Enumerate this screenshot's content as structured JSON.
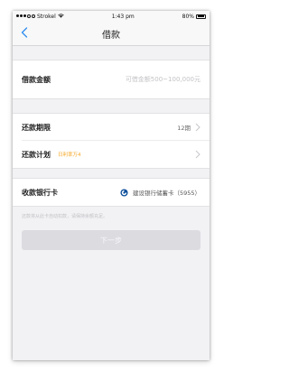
{
  "status_bar": {
    "carrier": "Strokel",
    "time": "1:43 pm",
    "battery": "80%",
    "battery_level": 0.8
  },
  "nav": {
    "title": "借款",
    "back_icon": "chevron-left-icon"
  },
  "form": {
    "amount": {
      "label": "借款金额",
      "placeholder": "可借金额500~100,000元",
      "value": ""
    },
    "term": {
      "label": "还款期限",
      "value": "12期"
    },
    "plan": {
      "label": "还款计划",
      "note": "日利率万4"
    },
    "bank": {
      "label": "收款银行卡",
      "name": "建设银行储蓄卡（5955）",
      "icon": "ccb-bank-icon"
    }
  },
  "hint": "还款将从此卡自动扣款，请保持余额充足。",
  "submit_button": {
    "label": "下一步",
    "enabled": false
  },
  "colors": {
    "accent": "#2f8cf0",
    "note": "#f5a623",
    "button_disabled": "#dcdce0",
    "background": "#f2f2f5"
  }
}
